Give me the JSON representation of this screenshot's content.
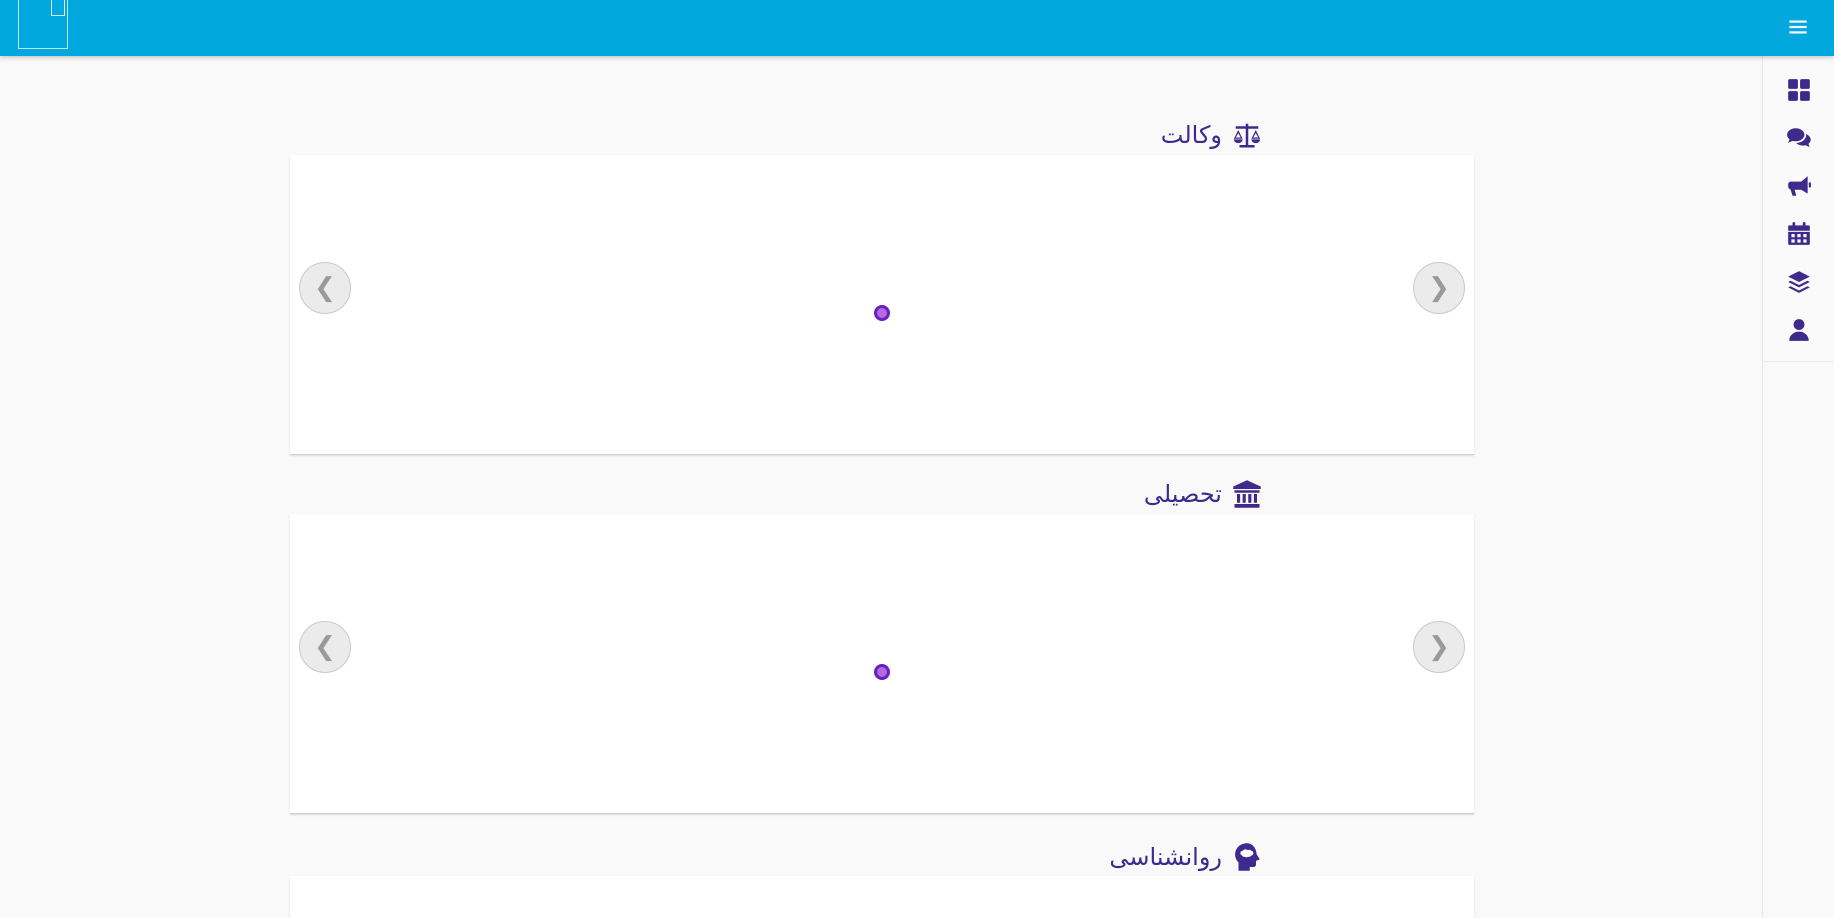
{
  "header": {
    "brand_color": "#00a8dd",
    "menu_icon": "hamburger-menu-icon"
  },
  "sidebar": {
    "items": [
      {
        "icon": "dashboard-grid-icon"
      },
      {
        "icon": "chat-comments-icon"
      },
      {
        "icon": "megaphone-icon"
      },
      {
        "icon": "calendar-icon"
      },
      {
        "icon": "layers-icon"
      },
      {
        "icon": "user-icon"
      }
    ],
    "icon_color": "#3d2a8c"
  },
  "sections": [
    {
      "title": "وکالت",
      "icon": "scale-balance-icon"
    },
    {
      "title": "تحصیلی",
      "icon": "university-icon"
    },
    {
      "title": "روانشناسی",
      "icon": "brain-head-icon"
    }
  ],
  "carousel": {
    "prev_glyph": "❮",
    "next_glyph": "❯",
    "indicator_color": "#6a1fbf"
  }
}
